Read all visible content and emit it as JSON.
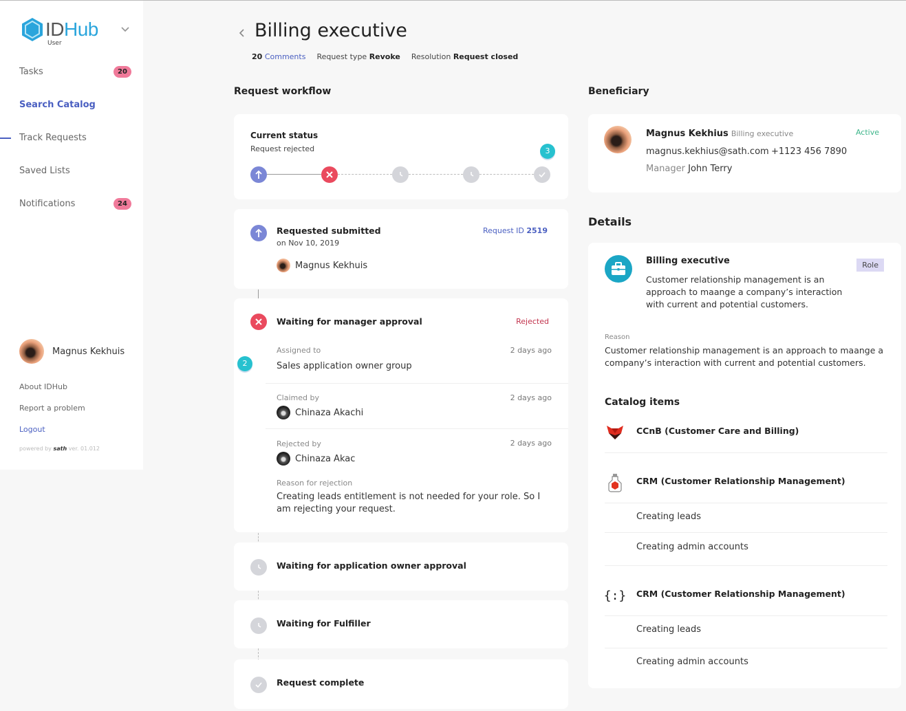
{
  "sidebar": {
    "logo": {
      "id": "ID",
      "hub": "Hub",
      "subtitle": "User"
    },
    "nav": [
      {
        "label": "Tasks",
        "badge": "20"
      },
      {
        "label": "Search Catalog"
      },
      {
        "label": "Track Requests"
      },
      {
        "label": "Saved Lists"
      },
      {
        "label": "Notifications",
        "badge": "24"
      }
    ],
    "user": {
      "name": "Magnus Kekhuis"
    },
    "links": {
      "about": "About IDHub",
      "report": "Report a problem",
      "logout": "Logout"
    },
    "powered": {
      "prefix": "powered by",
      "brand": "sath",
      "version": "ver. 01.012"
    }
  },
  "header": {
    "title": "Billing executive",
    "comments_count": "20",
    "comments_label": "Comments",
    "request_type_label": "Request type",
    "request_type": "Revoke",
    "resolution_label": "Resolution",
    "resolution": "Request closed"
  },
  "workflow": {
    "title": "Request workflow",
    "current_status": {
      "title": "Current status",
      "value": "Request rejected",
      "steps": [
        "submitted",
        "rejected",
        "pending",
        "pending",
        "pending-complete"
      ],
      "badge": "3"
    },
    "submitted": {
      "title": "Requested submitted",
      "date": "on Nov 10, 2019",
      "request_id_label": "Request ID",
      "request_id": "2519",
      "user": "Magnus Kekhuis"
    },
    "manager": {
      "title": "Waiting for manager approval",
      "status": "Rejected",
      "badge": "2",
      "assigned_label": "Assigned to",
      "assigned_time": "2 days ago",
      "assigned_value": "Sales application owner group",
      "claimed_label": "Claimed by",
      "claimed_time": "2 days ago",
      "claimed_user": "Chinaza Akachi",
      "rejected_label": "Rejected by",
      "rejected_time": "2 days ago",
      "rejected_user": "Chinaza Akac",
      "reason_label": "Reason for rejection",
      "reason": "Creating leads entitlement is not needed for your role. So I am rejecting your request."
    },
    "app_owner": {
      "title": "Waiting for application owner approval"
    },
    "fulfiller": {
      "title": "Waiting for Fulfiller"
    },
    "complete": {
      "title": "Request complete"
    }
  },
  "beneficiary": {
    "title": "Beneficiary",
    "name": "Magnus Kekhius",
    "role": "Billing executive",
    "status": "Active",
    "email": "magnus.kekhius@sath.com",
    "phone": "+1123 456 7890",
    "manager_label": "Manager",
    "manager": "John Terry"
  },
  "details": {
    "title": "Details",
    "role_title": "Billing executive",
    "role_tag": "Role",
    "role_desc": "Customer relationship management is an approach to maange a company’s interaction with current and potential customers.",
    "reason_label": "Reason",
    "reason": "Customer relationship management is an approach to maange a company’s interaction with current and potential customers.",
    "catalog_title": "Catalog items",
    "catalog": [
      {
        "name": "CCnB (Customer Care and Billing)",
        "icon": "fox-icon",
        "entitlements": []
      },
      {
        "name": "CRM (Customer Relationship Management)",
        "icon": "flask-icon",
        "entitlements": [
          "Creating leads",
          "Creating admin accounts"
        ]
      },
      {
        "name": "CRM (Customer Relationship Management)",
        "icon": "braces-icon",
        "entitlements": [
          "Creating leads",
          "Creating admin accounts"
        ]
      }
    ]
  },
  "colors": {
    "accent": "#4a5fc1",
    "badge": "#f07a9a",
    "rejected": "#ea4a5e",
    "active": "#3db58a",
    "teal": "#27c1cf"
  }
}
